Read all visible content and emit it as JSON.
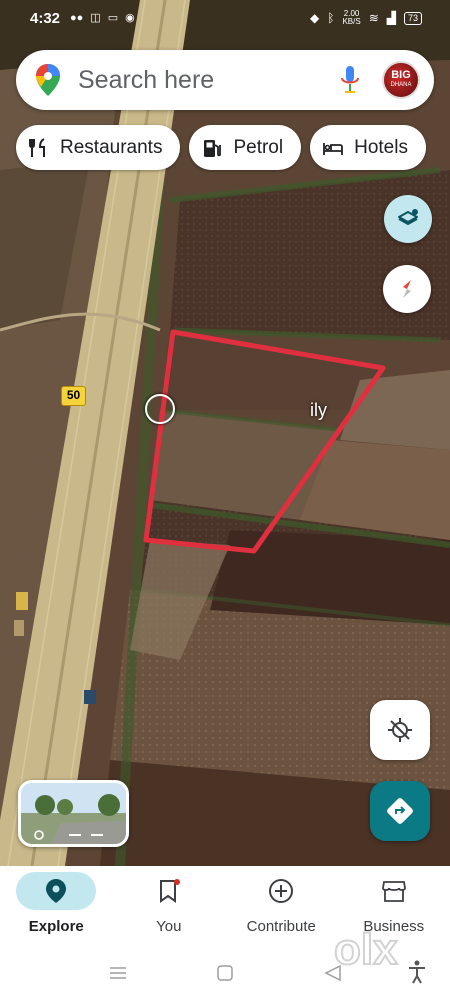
{
  "status_bar": {
    "time": "4:32",
    "net_speed_value": "2.00",
    "net_speed_unit": "KB/S",
    "battery": "73"
  },
  "search": {
    "placeholder": "Search here",
    "avatar_text": "BIG",
    "avatar_subtext": "DHANA"
  },
  "chips": [
    {
      "label": "Restaurants",
      "icon": "fork-knife-icon"
    },
    {
      "label": "Petrol",
      "icon": "fuel-pump-icon"
    },
    {
      "label": "Hotels",
      "icon": "bed-icon"
    }
  ],
  "map": {
    "road_number": "50",
    "place_label": "ily",
    "boundary_color": "#e0303f"
  },
  "bottom_nav": [
    {
      "label": "Explore",
      "icon": "location-pin-icon",
      "active": true
    },
    {
      "label": "You",
      "icon": "bookmark-icon",
      "active": false
    },
    {
      "label": "Contribute",
      "icon": "add-circle-icon",
      "active": false
    },
    {
      "label": "Business",
      "icon": "storefront-icon",
      "active": false
    }
  ],
  "watermark": "olx",
  "colors": {
    "accent": "#0b7a85",
    "active_pill": "#c2e7ef"
  }
}
